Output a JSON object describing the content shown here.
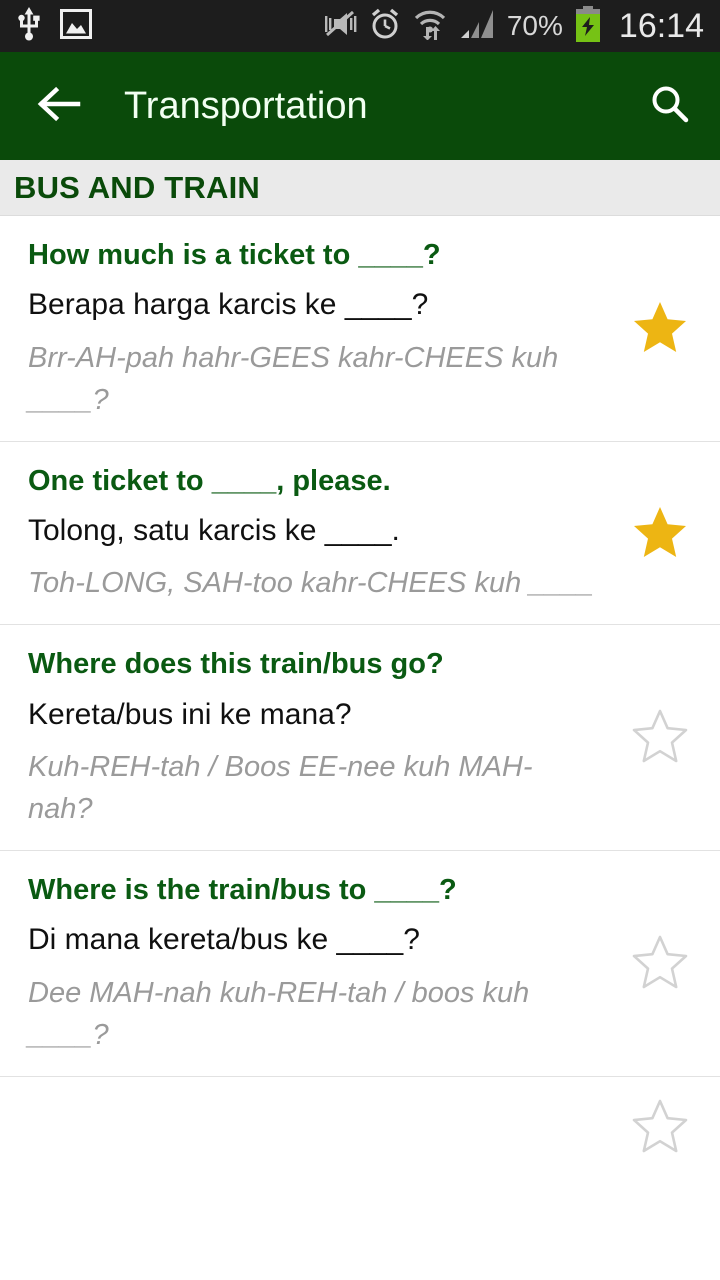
{
  "status_bar": {
    "icons_left": [
      "usb-icon",
      "screenshot-image-icon"
    ],
    "icons_right": [
      "mute-vibrate-icon",
      "alarm-clock-icon",
      "wifi-data-icon",
      "signal-bars-icon"
    ],
    "battery_percent": "70%",
    "battery_state": "charging",
    "clock": "16:14"
  },
  "app_bar": {
    "back_icon": "back-arrow-icon",
    "title": "Transportation",
    "search_icon": "search-icon"
  },
  "section": {
    "header": "BUS AND TRAIN"
  },
  "colors": {
    "app_bar_green": "#0a4a0a",
    "heading_green": "#0a5a12",
    "star_filled": "#edb513",
    "star_empty": "#d2d2d2",
    "section_bg": "#eaeaea",
    "pronunciation_gray": "#9a9a9a",
    "status_bar_bg": "#1d1d1d"
  },
  "entries": [
    {
      "english": "How much is a ticket to ____?",
      "translation": "Berapa harga karcis ke ____?",
      "pronunciation": "Brr-AH-pah  hahr-GEES  kahr-CHEES  kuh ____?",
      "starred": true,
      "star_icon": "star-filled-icon"
    },
    {
      "english": "One ticket to ____, please.",
      "translation": "Tolong, satu karcis ke ____.",
      "pronunciation": "Toh-LONG, SAH-too  kahr-CHEES  kuh  ____",
      "starred": true,
      "star_icon": "star-filled-icon"
    },
    {
      "english": "Where does this train/bus go?",
      "translation": "Kereta/bus ini ke mana?",
      "pronunciation": "Kuh-REH-tah / Boos  EE-nee  kuh  MAH-nah?",
      "starred": false,
      "star_icon": "star-outline-icon"
    },
    {
      "english": "Where is the train/bus to ____?",
      "translation": "Di mana kereta/bus ke ____?",
      "pronunciation": "Dee  MAH-nah  kuh-REH-tah / boos  kuh ____?",
      "starred": false,
      "star_icon": "star-outline-icon"
    },
    {
      "english": "",
      "translation": "",
      "pronunciation": "",
      "starred": false,
      "star_icon": "star-outline-icon"
    }
  ]
}
